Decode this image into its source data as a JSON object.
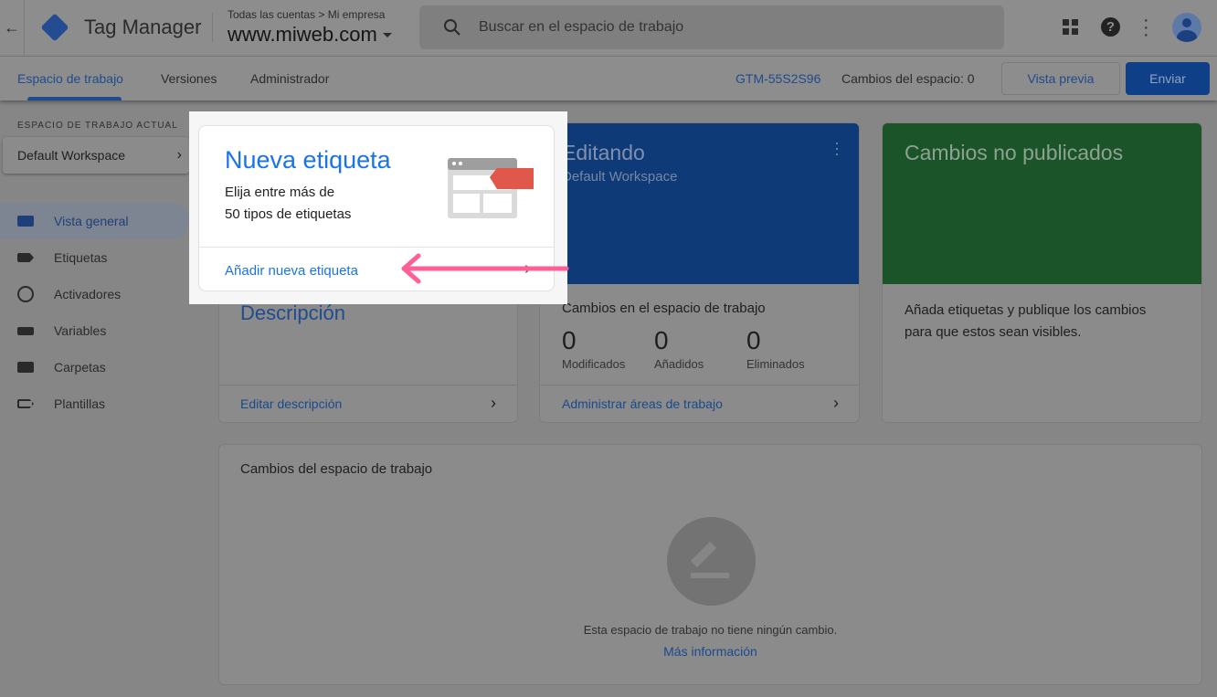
{
  "header": {
    "app_title": "Tag Manager",
    "breadcrumb": "Todas las cuentas > Mi empresa",
    "container": "www.miweb.com",
    "search_placeholder": "Buscar en el espacio de trabajo"
  },
  "tabs": [
    {
      "label": "Espacio de trabajo",
      "active": true
    },
    {
      "label": "Versiones"
    },
    {
      "label": "Administrador"
    }
  ],
  "toolbar": {
    "container_id": "GTM-55S2S96",
    "changes": "Cambios del espacio: 0",
    "preview": "Vista previa",
    "submit": "Enviar"
  },
  "sidebar": {
    "workspace_label": "ESPACIO DE TRABAJO ACTUAL",
    "workspace": "Default Workspace",
    "items": [
      {
        "label": "Vista general",
        "active": true,
        "icon": "overview-icon"
      },
      {
        "label": "Etiquetas",
        "icon": "tag-icon"
      },
      {
        "label": "Activadores",
        "icon": "trigger-icon"
      },
      {
        "label": "Variables",
        "icon": "variables-icon"
      },
      {
        "label": "Carpetas",
        "icon": "folder-icon"
      },
      {
        "label": "Plantillas",
        "icon": "template-icon"
      }
    ]
  },
  "new_tag": {
    "title": "Nueva etiqueta",
    "line1": "Elija entre más de",
    "line2": "50 tipos de etiquetas",
    "action": "Añadir nueva etiqueta"
  },
  "description": {
    "title": "Descripción",
    "action": "Editar descripción"
  },
  "editing": {
    "title": "Editando",
    "workspace": "Default Workspace",
    "section": "Cambios en el espacio de trabajo",
    "stats": [
      {
        "value": "0",
        "label": "Modificados"
      },
      {
        "value": "0",
        "label": "Añadidos"
      },
      {
        "value": "0",
        "label": "Eliminados"
      }
    ],
    "action": "Administrar áreas de trabajo"
  },
  "unpublished": {
    "title": "Cambios no publicados",
    "line1": "Añada etiquetas y publique los cambios",
    "line2": "para que estos sean visibles."
  },
  "workspace_changes": {
    "title": "Cambios del espacio de trabajo",
    "empty": "Esta espacio de trabajo no tiene ningún cambio.",
    "more": "Más información"
  },
  "colors": {
    "accent": "#1a73e8",
    "editing_card": "#0f3a78",
    "unpublished_card": "#1c5429",
    "arrow": "#ff5f97"
  }
}
